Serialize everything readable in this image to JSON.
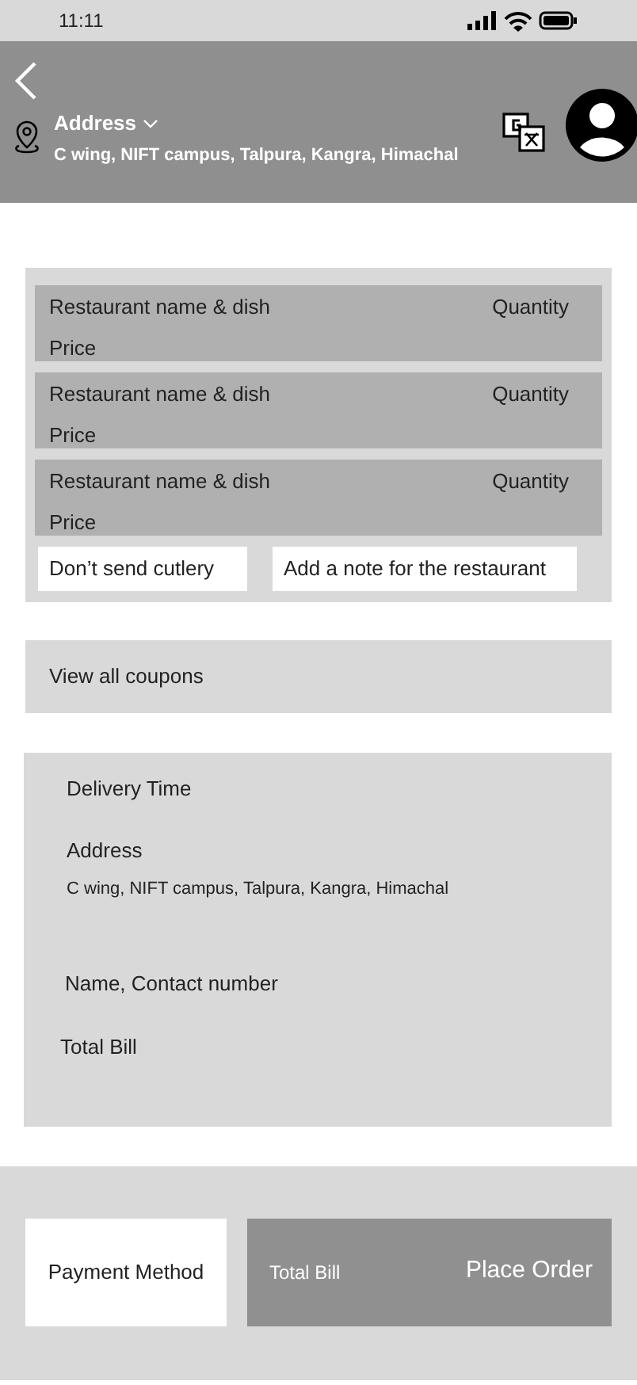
{
  "status_bar": {
    "time": "11:11"
  },
  "header": {
    "address_label": "Address",
    "address": "C wing, NIFT campus, Talpura, Kangra, Himachal"
  },
  "cart_items": [
    {
      "name": "Restaurant name & dish",
      "quantity": "Quantity",
      "price": "Price"
    },
    {
      "name": "Restaurant name & dish",
      "quantity": "Quantity",
      "price": "Price"
    },
    {
      "name": "Restaurant name & dish",
      "quantity": "Quantity",
      "price": "Price"
    }
  ],
  "cart_actions": [
    "Don’t send cutlery",
    "Add a note for the restaurant"
  ],
  "coupons": "View all coupons",
  "details": [
    {
      "kind": "label",
      "text": "Delivery Time"
    },
    {
      "kind": "address",
      "text": "Address",
      "value": "C wing, NIFT campus, Talpura, Kangra, Himachal"
    },
    {
      "kind": "label",
      "text": "Name, Contact number"
    },
    {
      "kind": "label",
      "text": "Total Bill"
    }
  ],
  "footer": {
    "payment": "Payment Method",
    "total": "Total Bill",
    "place_order": "Place Order"
  }
}
